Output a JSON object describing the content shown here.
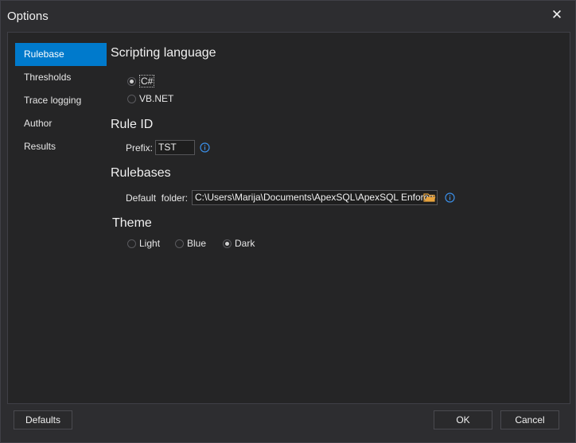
{
  "window": {
    "title": "Options",
    "close_glyph": "✕"
  },
  "sidebar": {
    "items": [
      {
        "label": "Rulebase",
        "active": true
      },
      {
        "label": "Thresholds",
        "active": false
      },
      {
        "label": "Trace logging",
        "active": false
      },
      {
        "label": "Author",
        "active": false
      },
      {
        "label": "Results",
        "active": false
      }
    ]
  },
  "scripting": {
    "title": "Scripting language",
    "options": [
      {
        "label": "C#",
        "selected": true
      },
      {
        "label": "VB.NET",
        "selected": false
      }
    ]
  },
  "rule_id": {
    "title": "Rule ID",
    "prefix_label": "Prefix:",
    "prefix_value": "TST"
  },
  "rulebases": {
    "title": "Rulebases",
    "folder_label": "Default  folder:",
    "folder_value": "C:\\Users\\Marija\\Documents\\ApexSQL\\ApexSQL Enforce"
  },
  "theme": {
    "title": "Theme",
    "options": [
      {
        "label": "Light",
        "selected": false
      },
      {
        "label": "Blue",
        "selected": false
      },
      {
        "label": "Dark",
        "selected": true
      }
    ]
  },
  "buttons": {
    "defaults": "Defaults",
    "ok": "OK",
    "cancel": "Cancel"
  },
  "colors": {
    "accent": "#007acc",
    "background": "#2d2d30",
    "panel": "#252526",
    "info_icon": "#3a8ee6",
    "folder_icon": "#e8a33d"
  },
  "icons": {
    "info": "info-icon",
    "folder": "folder-icon",
    "close": "close-icon"
  }
}
